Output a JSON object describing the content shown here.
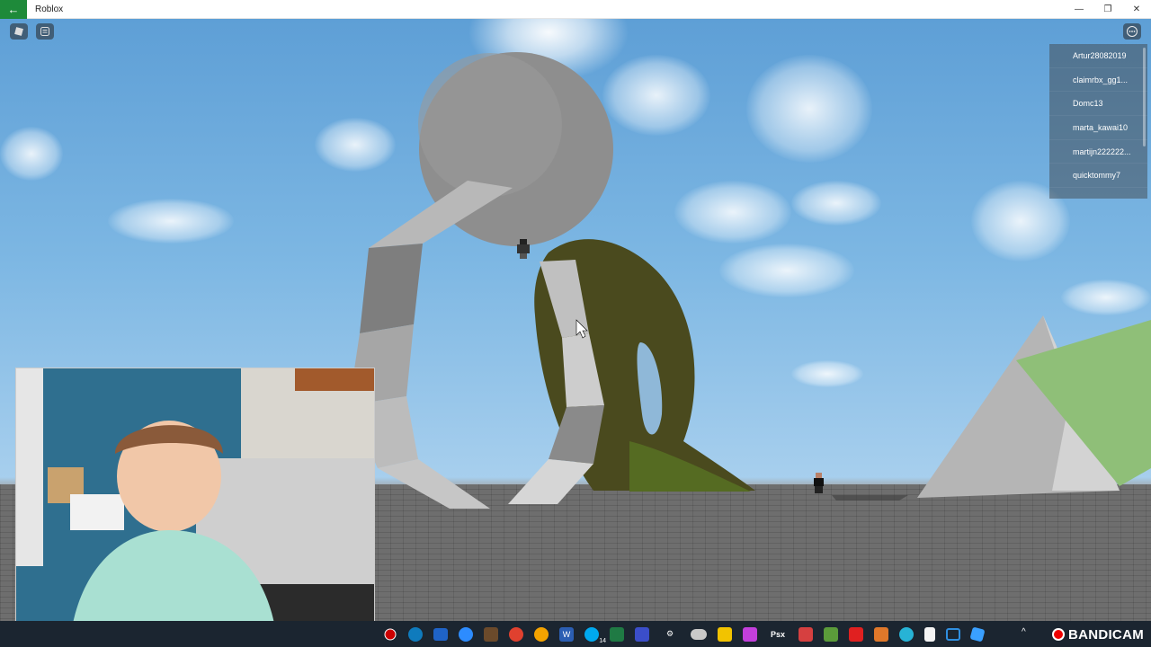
{
  "window": {
    "title": "Roblox",
    "back_icon": "arrow-left-icon",
    "controls": [
      "minimize-icon",
      "restore-icon",
      "close-icon"
    ]
  },
  "player_list": [
    "Artur28082019",
    "claimrbx_gg1...",
    "Domc13",
    "marta_kawai10",
    "martijn222222...",
    "quicktommy7"
  ],
  "overlay": {
    "recorder": "BANDICAM"
  },
  "taskbar": {
    "icons": [
      "record-icon",
      "edge-icon",
      "mail-icon",
      "zoom-icon",
      "minecraft-icon",
      "chrome-icon",
      "chrome-canary-icon",
      "word-icon",
      "skype-icon",
      "excel-icon",
      "snip-icon",
      "settings-icon",
      "onedrive-icon",
      "store-icon",
      "photos-icon",
      "psx-icon",
      "app-icon",
      "minecraft-edu-icon",
      "roblox-icon",
      "app-icon-2",
      "app-icon-3",
      "notepad-icon",
      "window-icon",
      "roblox-studio-icon"
    ],
    "skype_badge": "14"
  },
  "colors": {
    "sky": "#7db7e3",
    "baseplate": "#6e6e6e",
    "taskbar": "#1b2530",
    "accent": "#1e8a3a"
  }
}
